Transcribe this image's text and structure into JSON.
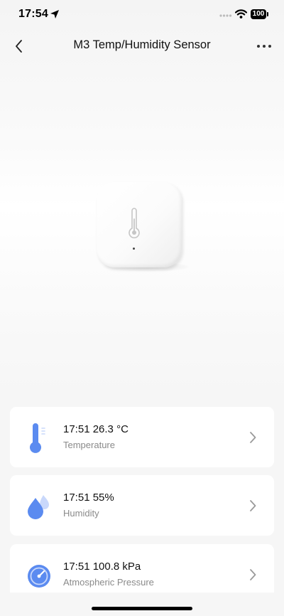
{
  "status_bar": {
    "time": "17:54",
    "battery": "100"
  },
  "nav": {
    "title": "M3 Temp/Humidity Sensor"
  },
  "icons": {
    "location": "location-arrow-icon",
    "signal": "cellular-signal-icon",
    "wifi": "wifi-icon",
    "back": "chevron-left-icon",
    "more": "ellipsis-icon",
    "temperature": "thermometer-icon",
    "humidity": "water-drops-icon",
    "pressure": "gauge-icon",
    "disclosure": "chevron-right-icon"
  },
  "colors": {
    "accent": "#5b8bf0",
    "accent_light": "#c9d8fb",
    "page_background": "#f6f6f6",
    "card_background": "#ffffff",
    "secondary_text": "#8a8a8a",
    "chevron": "#9a9a9a"
  },
  "readings": [
    {
      "value": "17:51 26.3 °C",
      "label": "Temperature"
    },
    {
      "value": "17:51 55%",
      "label": "Humidity"
    },
    {
      "value": "17:51 100.8 kPa",
      "label": "Atmospheric Pressure"
    }
  ]
}
